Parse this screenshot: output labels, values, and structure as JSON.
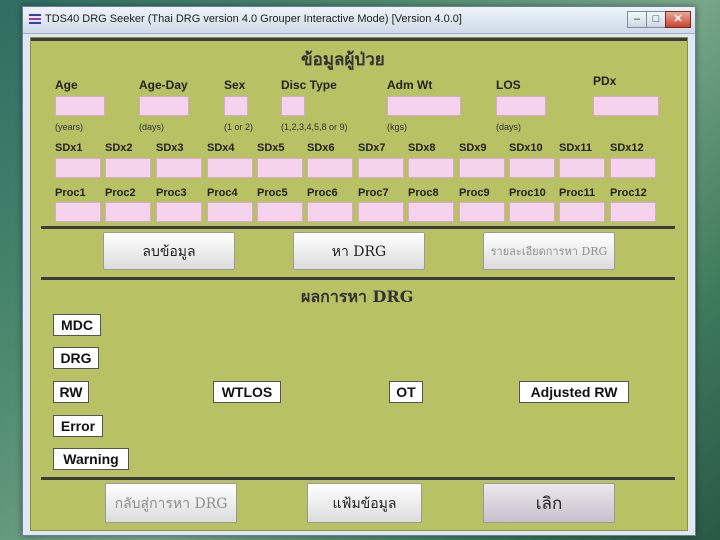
{
  "window": {
    "title": "TDS40    DRG Seeker (Thai DRG version 4.0 Grouper Interactive Mode) [Version 4.0.0]",
    "controls": {
      "minimize": "–",
      "maximize": "□",
      "close": "✕"
    }
  },
  "patient_section": {
    "title": "ข้อมูลผู้ป่วย",
    "fields": {
      "age": "Age",
      "age_day": "Age-Day",
      "sex": "Sex",
      "disc_type": "Disc Type",
      "adm_wt": "Adm Wt",
      "los": "LOS",
      "pdx": "PDx"
    },
    "hints": {
      "age": "(years)",
      "age_day": "(days)",
      "sex": "(1 or 2)",
      "disc_type": "(1,2,3,4,5,8 or 9)",
      "adm_wt": "(kgs)",
      "los": "(days)"
    },
    "sdx_labels": [
      "SDx1",
      "SDx2",
      "SDx3",
      "SDx4",
      "SDx5",
      "SDx6",
      "SDx7",
      "SDx8",
      "SDx9",
      "SDx10",
      "SDx11",
      "SDx12"
    ],
    "proc_labels": [
      "Proc1",
      "Proc2",
      "Proc3",
      "Proc4",
      "Proc5",
      "Proc6",
      "Proc7",
      "Proc8",
      "Proc9",
      "Proc10",
      "Proc11",
      "Proc12"
    ]
  },
  "actions": {
    "clear": "ลบข้อมูล",
    "find_drg": "หา DRG",
    "details": "รายละเอียดการหา DRG"
  },
  "result_section": {
    "title": "ผลการหา DRG",
    "mdc": "MDC",
    "drg": "DRG",
    "rw": "RW",
    "wtlos": "WTLOS",
    "ot": "OT",
    "adjusted_rw": "Adjusted RW",
    "error": "Error",
    "warning": "Warning"
  },
  "footer": {
    "back": "กลับสู่การหา DRG",
    "save": "แฟ้มข้อมูล",
    "exit": "เลิก"
  },
  "colors": {
    "form_bg": "#b8c164",
    "input_bg": "#f5d3ec"
  }
}
